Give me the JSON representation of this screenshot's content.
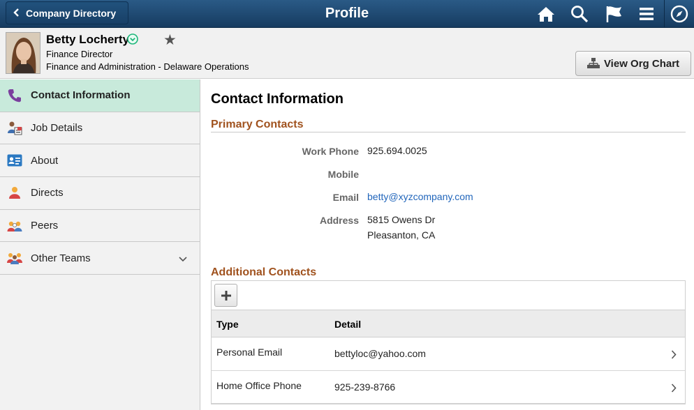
{
  "topbar": {
    "back_label": "Company Directory",
    "title": "Profile",
    "icons": [
      "home-icon",
      "search-icon",
      "flag-icon",
      "menu-icon",
      "navbar-compass-icon"
    ]
  },
  "profile": {
    "name": "Betty Locherty",
    "job_title": "Finance Director",
    "department": "Finance and Administration - Delaware Operations",
    "org_chart_button": "View Org Chart"
  },
  "sidebar": {
    "items": [
      {
        "label": "Contact Information",
        "icon": "phone-icon",
        "active": true
      },
      {
        "label": "Job Details",
        "icon": "job-details-icon",
        "active": false
      },
      {
        "label": "About",
        "icon": "id-card-icon",
        "active": false
      },
      {
        "label": "Directs",
        "icon": "directs-icon",
        "active": false
      },
      {
        "label": "Peers",
        "icon": "peers-icon",
        "active": false
      },
      {
        "label": "Other Teams",
        "icon": "teams-icon",
        "active": false
      }
    ]
  },
  "content": {
    "title": "Contact Information",
    "primary_title": "Primary Contacts",
    "fields": {
      "work_phone_label": "Work Phone",
      "work_phone_value": "925.694.0025",
      "mobile_label": "Mobile",
      "email_label": "Email",
      "email_value": "betty@xyzcompany.com",
      "address_label": "Address",
      "address_line1": "5815 Owens Dr",
      "address_line2": "Pleasanton, CA"
    },
    "additional_title": "Additional Contacts",
    "grid": {
      "headers": [
        "Type",
        "Detail"
      ],
      "rows": [
        {
          "type": "Personal Email",
          "detail": "bettyloc@yahoo.com"
        },
        {
          "type": "Home Office Phone",
          "detail": "925-239-8766"
        }
      ]
    }
  },
  "colors": {
    "topbar": "#1e4a73",
    "active_nav": "#c8eadb",
    "section_title": "#a0521e",
    "link": "#2266bb"
  }
}
